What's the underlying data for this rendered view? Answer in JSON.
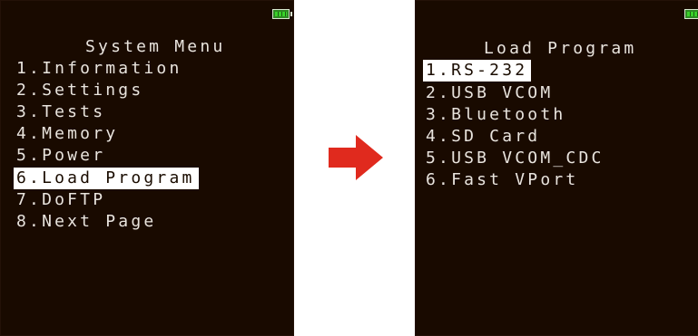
{
  "left_screen": {
    "title": "System Menu",
    "battery_icon": "battery-full-icon",
    "items": [
      {
        "label": "1.Information",
        "selected": false
      },
      {
        "label": "2.Settings",
        "selected": false
      },
      {
        "label": "3.Tests",
        "selected": false
      },
      {
        "label": "4.Memory",
        "selected": false
      },
      {
        "label": "5.Power",
        "selected": false
      },
      {
        "label": "6.Load Program",
        "selected": true
      },
      {
        "label": "7.DoFTP",
        "selected": false
      },
      {
        "label": "8.Next Page",
        "selected": false
      }
    ]
  },
  "transition": {
    "icon": "arrow-right-icon",
    "color": "#e02a1e"
  },
  "right_screen": {
    "title": "Load Program",
    "battery_icon": "battery-full-icon",
    "items": [
      {
        "label": "1.RS-232",
        "selected": true
      },
      {
        "label": "2.USB VCOM",
        "selected": false
      },
      {
        "label": "3.Bluetooth",
        "selected": false
      },
      {
        "label": "4.SD Card",
        "selected": false
      },
      {
        "label": "5.USB VCOM_CDC",
        "selected": false
      },
      {
        "label": "6.Fast VPort",
        "selected": false
      }
    ]
  },
  "colors": {
    "screen_background": "#190a00",
    "text": "#e9e4de",
    "highlight_background": "#ffffff",
    "highlight_text": "#1a0c00",
    "battery": "#39d12a"
  }
}
